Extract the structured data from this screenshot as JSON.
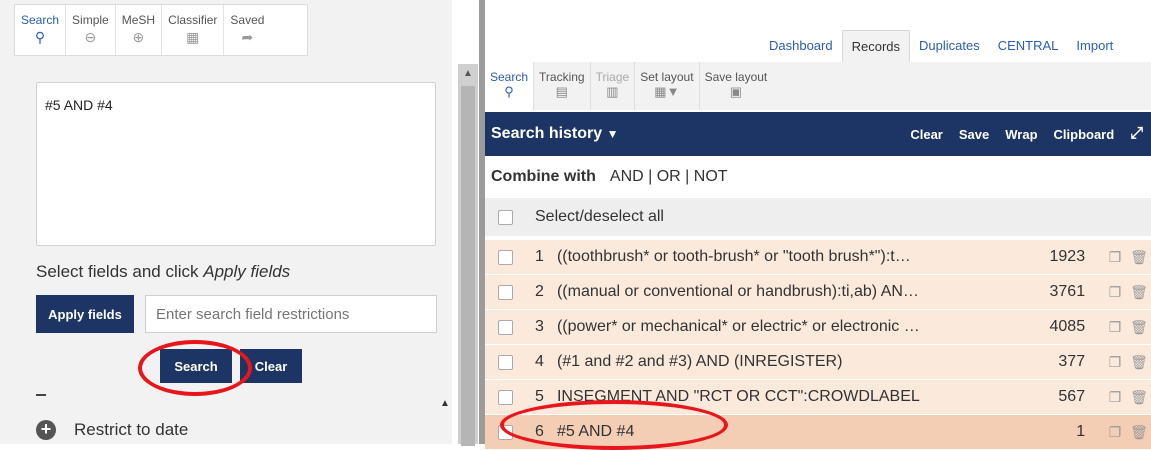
{
  "left_tabs": [
    {
      "label": "Search",
      "icon": "search-icon",
      "active": true
    },
    {
      "label": "Simple",
      "icon": "zoom-out-icon",
      "active": false
    },
    {
      "label": "MeSH",
      "icon": "zoom-in-icon",
      "active": false
    },
    {
      "label": "Classifier",
      "icon": "chart-icon",
      "active": false
    },
    {
      "label": "Saved",
      "icon": "share-arrow-icon",
      "active": false
    }
  ],
  "query": {
    "value": "#5 AND #4"
  },
  "fields": {
    "label_prefix": "Select fields and click ",
    "label_italic": "Apply fields",
    "apply_button": "Apply fields",
    "placeholder": "Enter search field restrictions"
  },
  "actions": {
    "search": "Search",
    "clear": "Clear"
  },
  "restrict": {
    "label": "Restrict to date",
    "icon": "plus-circle-icon"
  },
  "top_tabs": [
    {
      "label": "Dashboard",
      "active": false
    },
    {
      "label": "Records",
      "active": true
    },
    {
      "label": "Duplicates",
      "active": false
    },
    {
      "label": "CENTRAL",
      "active": false
    },
    {
      "label": "Import",
      "active": false
    }
  ],
  "tools": [
    {
      "label": "Search",
      "icon": "search-icon",
      "active": true
    },
    {
      "label": "Tracking",
      "icon": "tracking-icon",
      "active": false
    },
    {
      "label": "Triage",
      "icon": "triage-icon",
      "active": false
    },
    {
      "label": "Set layout",
      "icon": "grid-dropdown-icon",
      "active": false
    },
    {
      "label": "Save layout",
      "icon": "floppy-disk-icon",
      "active": false
    }
  ],
  "history": {
    "title": "Search history",
    "clear": "Clear",
    "save": "Save",
    "wrap": "Wrap",
    "clipboard": "Clipboard"
  },
  "combine": {
    "label": "Combine with",
    "options": "AND | OR | NOT"
  },
  "select_all": "Select/deselect all",
  "rows": [
    {
      "n": "1",
      "q": "((toothbrush* or tooth-brush* or \"tooth brush*\"):t…",
      "count": "1923"
    },
    {
      "n": "2",
      "q": "((manual or conventional or handbrush):ti,ab) AN…",
      "count": "3761"
    },
    {
      "n": "3",
      "q": "((power* or mechanical* or electric* or electronic …",
      "count": "4085"
    },
    {
      "n": "4",
      "q": "(#1 and #2 and #3) AND (INREGISTER)",
      "count": "377"
    },
    {
      "n": "5",
      "q": "INSEGMENT AND \"RCT OR CCT\":CROWDLABEL",
      "count": "567"
    },
    {
      "n": "6",
      "q": "#5 AND #4",
      "count": "1"
    }
  ]
}
